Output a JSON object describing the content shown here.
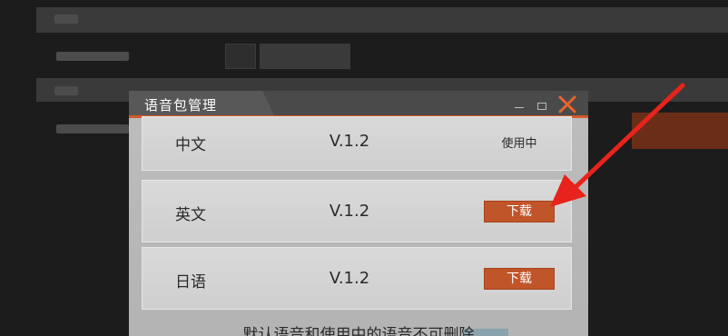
{
  "dialog": {
    "title": "语音包管理",
    "rows": [
      {
        "language": "中文",
        "version": "V.1.2",
        "status": "使用中"
      },
      {
        "language": "英文",
        "version": "V.1.2",
        "action": "下载"
      },
      {
        "language": "日语",
        "version": "V.1.2",
        "action": "下载"
      }
    ],
    "note": "默认语音和使用中的语音不可删除"
  },
  "colors": {
    "accent": "#d25a2a",
    "button": "#c1552a",
    "annotation_arrow": "#e8231c"
  },
  "icons": {
    "close": "close-icon",
    "minimize": "minimize-icon",
    "maximize": "maximize-icon"
  }
}
